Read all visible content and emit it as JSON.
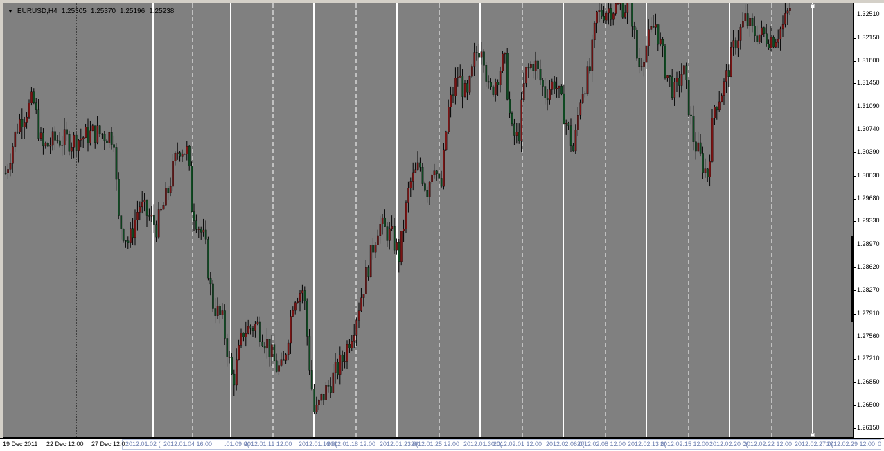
{
  "window": {
    "symbol": "EURUSD,H4",
    "ohlc": [
      "1.25305",
      "1.25370",
      "1.25196",
      "1.25238"
    ]
  },
  "colors": {
    "background": "#808080",
    "bull": "#7b1414",
    "bear": "#0f4a22",
    "wick": "#000000",
    "grid_major": "#ffffff",
    "grid_minor": "#ffffff"
  },
  "price_axis": {
    "labels": [
      "1.32510",
      "1.32150",
      "1.31800",
      "1.31450",
      "1.31090",
      "1.30740",
      "1.30390",
      "1.30030",
      "1.29680",
      "1.29330",
      "1.28970",
      "1.28620",
      "1.28270",
      "1.27910",
      "1.27560",
      "1.27210",
      "1.26850",
      "1.26500",
      "1.26150"
    ],
    "max": 1.3269,
    "min": 1.26
  },
  "time_axis": {
    "labels": [
      "19 Dec 2011",
      "22 Dec 12:00",
      "27 Dec 12:0",
      "2012.01.02 (",
      "2012.01.04 16:00",
      ".01.09 0(",
      "2012.01.11 12:00",
      "2012.01.16 0(",
      "2012.01.18 12:00",
      "2012.01.23 0(",
      "2012.01.25 12:00",
      "2012.01.30 0(",
      "2012.02.01 12:00",
      "2012.02.06 0(",
      "2012.02.08 12:00",
      "2012.02.13 0(",
      "2012.02.15 12:00",
      "2012.02.20 0(",
      "2012.02.22 12:00",
      "2012.02.27 0(",
      "2012.02.29 12:00",
      "0"
    ]
  },
  "vlines": {
    "solid": [
      216,
      328,
      448,
      568,
      688,
      808,
      928,
      1048,
      1168
    ],
    "dashed": [
      273,
      389,
      509,
      629,
      749,
      869,
      989,
      1109
    ],
    "dotted": [
      105
    ]
  },
  "series_path": [
    [
      0,
      1.3
    ],
    [
      20,
      1.3085
    ],
    [
      42,
      1.312
    ],
    [
      55,
      1.3045
    ],
    [
      75,
      1.306
    ],
    [
      100,
      1.3058
    ],
    [
      130,
      1.307
    ],
    [
      160,
      1.3065
    ],
    [
      163,
      1.294
    ],
    [
      180,
      1.29
    ],
    [
      195,
      1.296
    ],
    [
      220,
      1.2925
    ],
    [
      235,
      1.2975
    ],
    [
      252,
      1.305
    ],
    [
      265,
      1.304
    ],
    [
      270,
      1.296
    ],
    [
      290,
      1.29
    ],
    [
      300,
      1.281
    ],
    [
      315,
      1.278
    ],
    [
      330,
      1.2685
    ],
    [
      345,
      1.2765
    ],
    [
      365,
      1.2775
    ],
    [
      380,
      1.2745
    ],
    [
      392,
      1.271
    ],
    [
      402,
      1.2705
    ],
    [
      418,
      1.282
    ],
    [
      432,
      1.283
    ],
    [
      440,
      1.272
    ],
    [
      448,
      1.2635
    ],
    [
      460,
      1.2665
    ],
    [
      475,
      1.2695
    ],
    [
      490,
      1.2725
    ],
    [
      505,
      1.2775
    ],
    [
      520,
      1.284
    ],
    [
      540,
      1.293
    ],
    [
      560,
      1.291
    ],
    [
      570,
      1.288
    ],
    [
      585,
      1.299
    ],
    [
      600,
      1.302
    ],
    [
      610,
      1.298
    ],
    [
      620,
      1.303
    ],
    [
      630,
      1.2975
    ],
    [
      640,
      1.31
    ],
    [
      655,
      1.316
    ],
    [
      668,
      1.312
    ],
    [
      680,
      1.319
    ],
    [
      690,
      1.321
    ],
    [
      700,
      1.3125
    ],
    [
      712,
      1.316
    ],
    [
      722,
      1.3185
    ],
    [
      732,
      1.307
    ],
    [
      742,
      1.306
    ],
    [
      752,
      1.316
    ],
    [
      765,
      1.318
    ],
    [
      780,
      1.313
    ],
    [
      795,
      1.315
    ],
    [
      808,
      1.31
    ],
    [
      822,
      1.304
    ],
    [
      832,
      1.313
    ],
    [
      845,
      1.3165
    ],
    [
      855,
      1.325
    ],
    [
      870,
      1.326
    ],
    [
      890,
      1.3265
    ],
    [
      905,
      1.326
    ],
    [
      915,
      1.317
    ],
    [
      925,
      1.32
    ],
    [
      940,
      1.324
    ],
    [
      955,
      1.3165
    ],
    [
      968,
      1.313
    ],
    [
      980,
      1.317
    ],
    [
      995,
      1.306
    ],
    [
      1005,
      1.303
    ],
    [
      1015,
      1.3005
    ],
    [
      1025,
      1.311
    ],
    [
      1040,
      1.3145
    ],
    [
      1055,
      1.321
    ],
    [
      1070,
      1.3245
    ],
    [
      1080,
      1.3225
    ],
    [
      1095,
      1.322
    ],
    [
      1110,
      1.3215
    ],
    [
      1125,
      1.3235
    ],
    [
      1135,
      1.3265
    ]
  ]
}
